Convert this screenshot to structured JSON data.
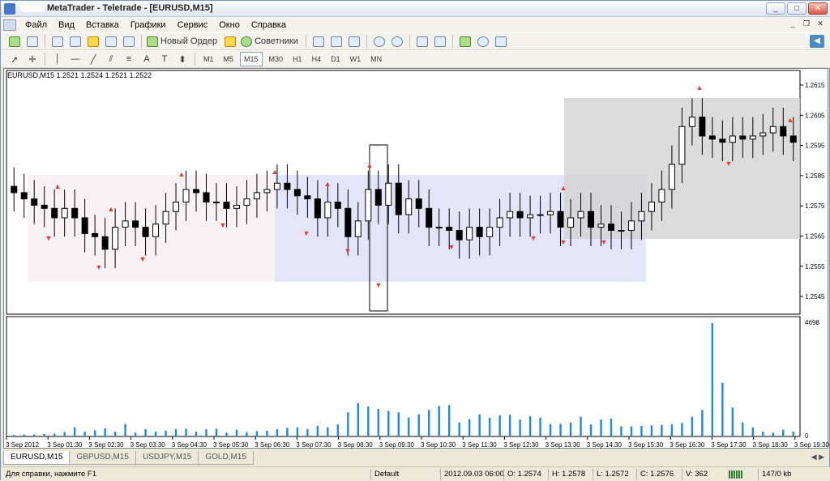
{
  "window": {
    "title": "MetaTrader - Teletrade - [EURUSD,M15]",
    "buttons": {
      "minimize": "_",
      "maximize": "□",
      "close": "✕"
    }
  },
  "menu": [
    "Файл",
    "Вид",
    "Вставка",
    "Графики",
    "Сервис",
    "Окно",
    "Справка"
  ],
  "mdi_buttons": [
    "_",
    "❐",
    "✕"
  ],
  "toolbar": {
    "new_order": "Новый Ордер",
    "advisors": "Советники"
  },
  "timeframes": [
    "M1",
    "M5",
    "M15",
    "M30",
    "H1",
    "H4",
    "D1",
    "W1",
    "MN"
  ],
  "active_timeframe": "M15",
  "drawing_tools": [
    "A",
    "T"
  ],
  "chart": {
    "symbol_info": "EURUSD,M15  1.2521 1.2524 1.2521 1.2522",
    "price_labels": [
      "1.2615",
      "1.2605",
      "1.2595",
      "1.2585",
      "1.2575",
      "1.2565",
      "1.2555",
      "1.2545"
    ],
    "volume_labels": [
      "4698",
      "0"
    ],
    "time_labels": [
      "3 Sep 2012",
      "3 Sep 01:30",
      "3 Sep 02:30",
      "3 Sep 03:30",
      "3 Sep 04:30",
      "3 Sep 05:30",
      "3 Sep 06:30",
      "3 Sep 07:30",
      "3 Sep 08:30",
      "3 Sep 09:30",
      "3 Sep 10:30",
      "3 Sep 11:30",
      "3 Sep 12:30",
      "3 Sep 13:30",
      "3 Sep 14:30",
      "3 Sep 15:30",
      "3 Sep 16:30",
      "3 Sep 17:30",
      "3 Sep 18:30",
      "3 Sep 19:30"
    ],
    "colors": {
      "bull": "#ffffff",
      "bear": "#000000",
      "volume": "#1e88e5",
      "fractal": "#e53935",
      "zone1": "#f8f2f4",
      "zone2": "#e5e5fa",
      "zone3": "#d3d3d3"
    }
  },
  "tabs": [
    "EURUSD,M15",
    "GBPUSD,M15",
    "USDJPY,M15",
    "GOLD,M15"
  ],
  "active_tab": "EURUSD,M15",
  "status": {
    "help": "Для справки, нажмите F1",
    "profile": "Default",
    "datetime": "2012.09.03 06:00",
    "open": "O: 1.2574",
    "high": "H: 1.2578",
    "low": "L: 1.2572",
    "close": "C: 1.2576",
    "volume": "V: 362",
    "traffic": "147/0 kb"
  }
}
